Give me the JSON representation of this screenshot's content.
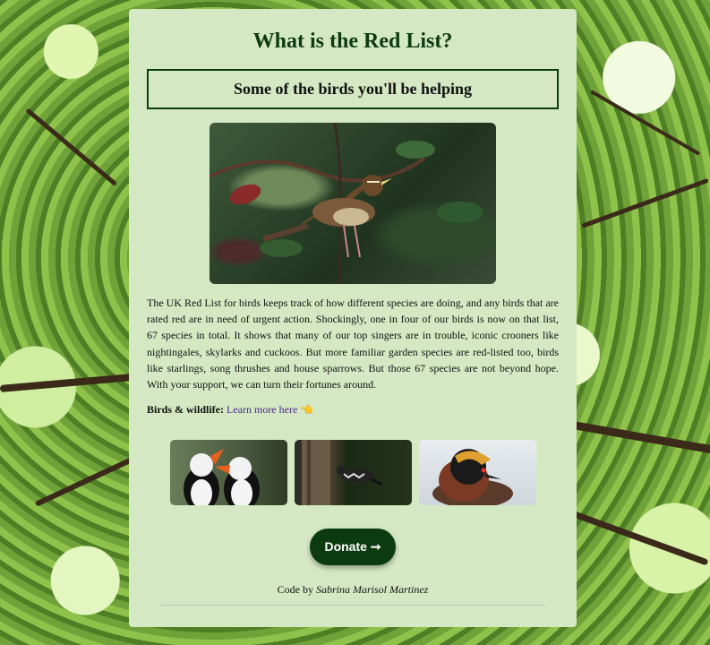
{
  "page": {
    "title": "What is the Red List?",
    "subtitle": "Some of the birds you'll be helping",
    "paragraph": "The UK Red List for birds keeps track of how different species are doing, and any birds that are rated red are in need of urgent action. Shockingly, one in four of our birds is now on that list, 67 species in total. It shows that many of our top singers are in trouble, iconic crooners like nightingales, skylarks and cuckoos. But more familiar garden species are red-listed too, birds like starlings, song thrushes and house sparrows. But those 67 species are not beyond hope. With your support, we can turn their fortunes around.",
    "learn_label": "Birds & wildlife:",
    "learn_link": "Learn more here",
    "learn_emoji": "👈",
    "donate_label": "Donate",
    "donate_arrow": "➞",
    "footer_prefix": "Code by",
    "footer_author": "Sabrina Marisol Martinez"
  },
  "images": {
    "hero": "redwing-bird-photo",
    "thumbs": [
      "puffins-photo",
      "woodpecker-photo",
      "grebe-photo"
    ]
  },
  "colors": {
    "card_bg": "#d5e8c4",
    "accent": "#0d3b10",
    "link": "#4a2a8a"
  }
}
